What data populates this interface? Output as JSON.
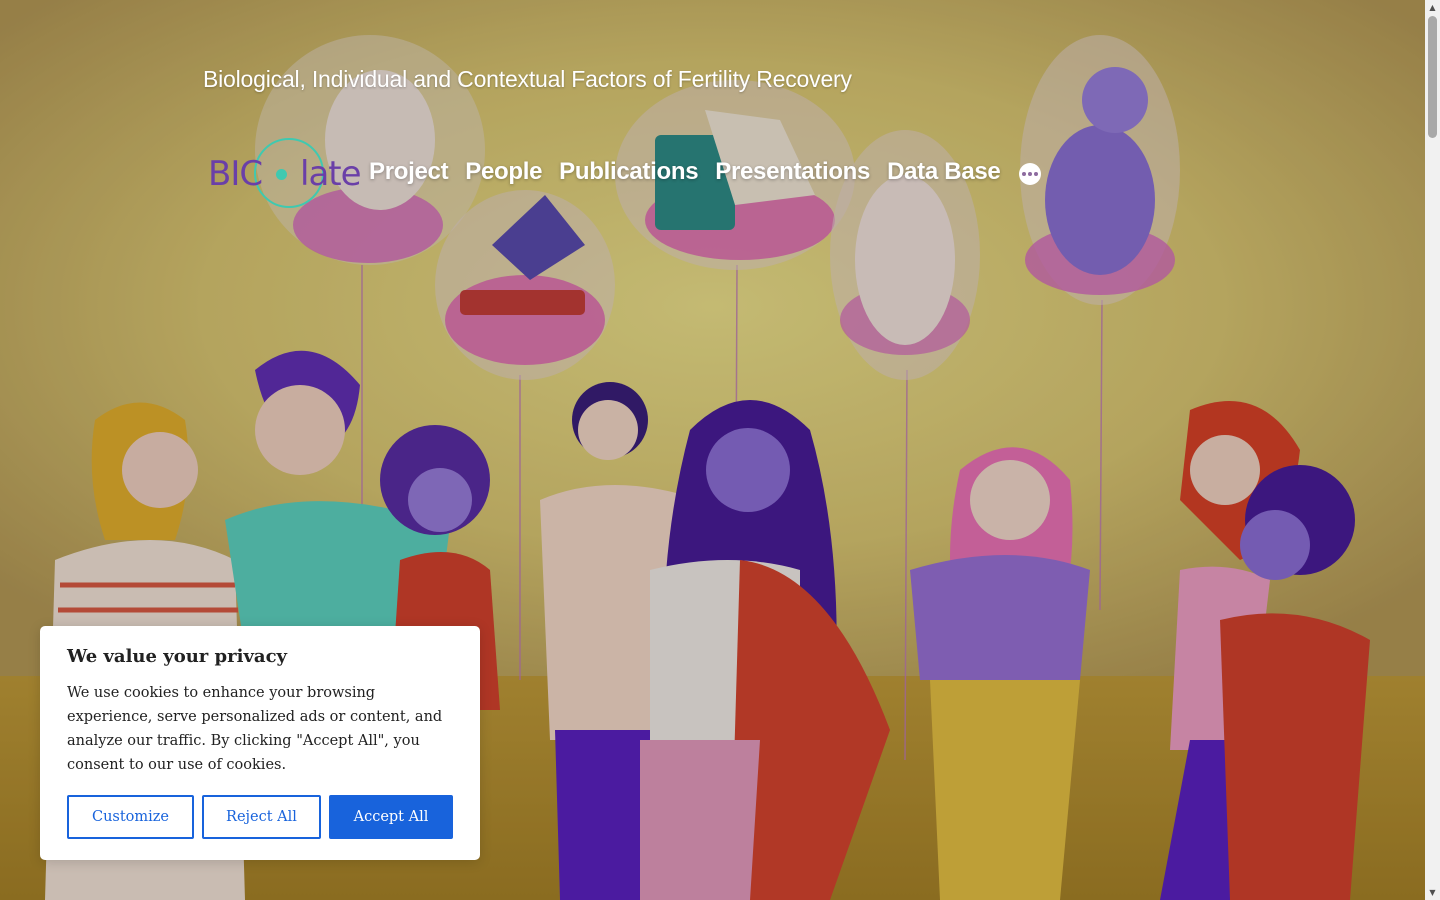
{
  "site": {
    "tagline": "Biological, Individual and Contextual Factors of Fertility Recovery",
    "logo": {
      "left_text": "BIC",
      "right_text": "late",
      "text_color": "#6a3fa8",
      "ring_color": "#3fc9b0"
    }
  },
  "nav": {
    "items": [
      {
        "label": "Project"
      },
      {
        "label": "People"
      },
      {
        "label": "Publications"
      },
      {
        "label": "Presentations"
      },
      {
        "label": "Data Base"
      }
    ],
    "more_icon": "ellipsis-icon"
  },
  "hero": {
    "illustration": "people-with-baby-balloons",
    "colors": {
      "wall_top": "#c9ad66",
      "wall_glow": "#eee08a",
      "floor": "#b7932f",
      "purple": "#6a3fb5",
      "pink": "#e070b0",
      "red": "#d6432e"
    }
  },
  "cookie_banner": {
    "title": "We value your privacy",
    "text": "We use cookies to enhance your browsing experience, serve personalized ads or content, and analyze our traffic. By clicking \"Accept All\", you consent to our use of cookies.",
    "buttons": {
      "customize": "Customize",
      "reject": "Reject All",
      "accept": "Accept All"
    },
    "accent_color": "#1863dc"
  },
  "scrollbar": {
    "up_icon": "triangle-up-icon",
    "down_icon": "triangle-down-icon"
  }
}
